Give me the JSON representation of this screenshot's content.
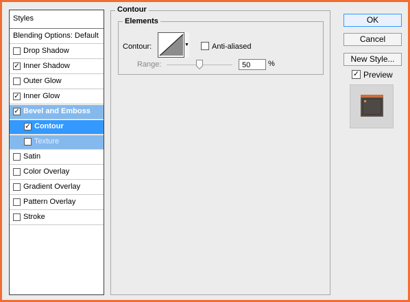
{
  "styles": {
    "header": "Styles",
    "items": [
      {
        "label": "Blending Options: Default",
        "checked": null,
        "state": "blend"
      },
      {
        "label": "Drop Shadow",
        "checked": false,
        "state": "normal"
      },
      {
        "label": "Inner Shadow",
        "checked": true,
        "state": "normal"
      },
      {
        "label": "Outer Glow",
        "checked": false,
        "state": "normal"
      },
      {
        "label": "Inner Glow",
        "checked": true,
        "state": "normal"
      },
      {
        "label": "Bevel and Emboss",
        "checked": true,
        "state": "parent-selected"
      },
      {
        "label": "Contour",
        "checked": true,
        "state": "selected"
      },
      {
        "label": "Texture",
        "checked": false,
        "state": "sub"
      },
      {
        "label": "Satin",
        "checked": false,
        "state": "normal"
      },
      {
        "label": "Color Overlay",
        "checked": false,
        "state": "normal"
      },
      {
        "label": "Gradient Overlay",
        "checked": false,
        "state": "normal"
      },
      {
        "label": "Pattern Overlay",
        "checked": false,
        "state": "normal"
      },
      {
        "label": "Stroke",
        "checked": false,
        "state": "normal"
      }
    ]
  },
  "contour_panel": {
    "title": "Contour",
    "elements_title": "Elements",
    "contour_label": "Contour:",
    "anti_aliased_label": "Anti-aliased",
    "anti_aliased": false,
    "range_label": "Range:",
    "range_value": "50",
    "range_unit": "%",
    "range_level": 0.5
  },
  "buttons": {
    "ok": "OK",
    "cancel": "Cancel",
    "new_style": "New Style..."
  },
  "preview": {
    "label": "Preview",
    "checked": true
  },
  "colors": {
    "frame": "#f26d35",
    "selection": "#3399ff",
    "selection_light": "#84b9ee"
  }
}
